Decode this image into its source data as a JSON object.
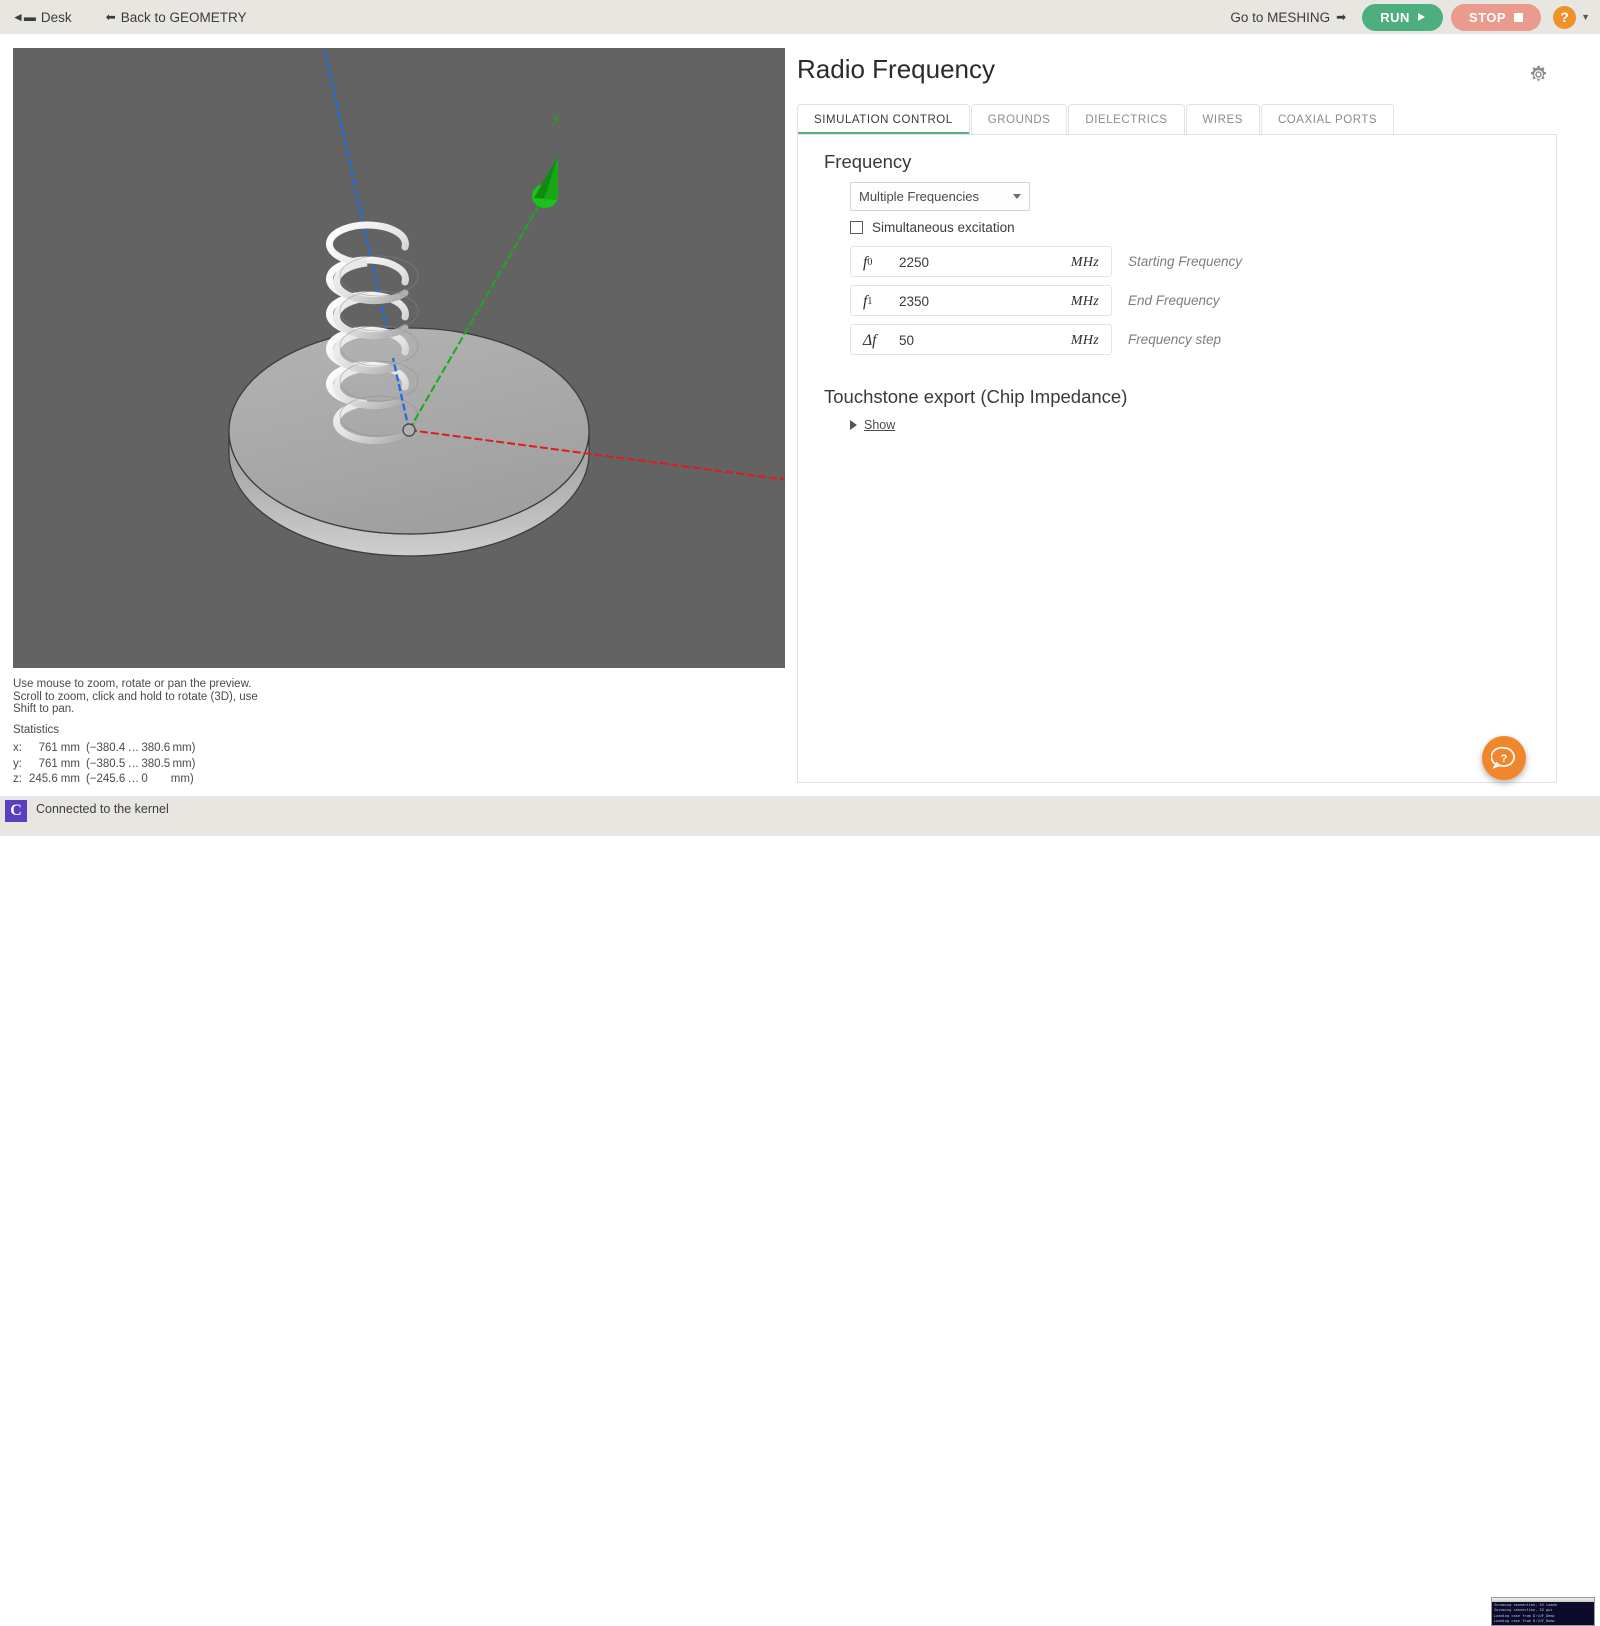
{
  "topbar": {
    "desk_label": "Desk",
    "desk_icon": "double-arrow-left-icon",
    "back_label": "Back to GEOMETRY",
    "back_icon": "arrow-left-icon",
    "goto_label": "Go to MESHING",
    "goto_icon": "arrow-right-icon",
    "run_label": "RUN",
    "run_icon": "play-icon",
    "stop_label": "STOP",
    "stop_icon": "stop-square-icon",
    "help_label": "?",
    "help_caret": "▼",
    "run_color": "#4caf7d",
    "stop_color": "#eb9a8e",
    "help_color": "#f0922b"
  },
  "viewport": {
    "axis_label_y": "y",
    "axis_color_x": "#e01b1b",
    "axis_color_y": "#18ac18",
    "axis_color_z": "#1e6ee0",
    "focus_icon": "center-focus-icon",
    "expand_icon": "expand-arrows-icon",
    "background_color": "#636363"
  },
  "hints": {
    "line1": "Use mouse to zoom, rotate or pan the preview.",
    "line2": "Scroll to zoom, click and hold to rotate (3D), use",
    "line3": "Shift to pan."
  },
  "statistics": {
    "title": "Statistics",
    "rows": [
      {
        "axis": "x:",
        "size": "761",
        "unit": "mm",
        "range": "(−380.4 … 380.6 mm)"
      },
      {
        "axis": "y:",
        "size": "761",
        "unit": "mm",
        "range": "(−380.5 … 380.5 mm)"
      },
      {
        "axis": "z:",
        "size": "245.6",
        "unit": "mm",
        "range": "(−245.6 … 0  mm)"
      }
    ]
  },
  "panel": {
    "title": "Radio Frequency",
    "gear_icon": "gear-icon",
    "tabs": [
      {
        "label": "SIMULATION CONTROL",
        "active": true
      },
      {
        "label": "GROUNDS",
        "active": false
      },
      {
        "label": "DIELECTRICS",
        "active": false
      },
      {
        "label": "WIRES",
        "active": false
      },
      {
        "label": "COAXIAL PORTS",
        "active": false
      }
    ],
    "active_tab_accent": "#55b37c"
  },
  "frequency": {
    "heading": "Frequency",
    "mode_value": "Multiple Frequencies",
    "mode_caret_icon": "chevron-down-icon",
    "simultaneous_excitation_label": "Simultaneous excitation",
    "simultaneous_excitation_checked": false,
    "fields": [
      {
        "sym": "f",
        "sub": "0",
        "value": "2250",
        "placeholder": "2250",
        "unit": "MHz",
        "desc": "Starting Frequency"
      },
      {
        "sym": "f",
        "sub": "1",
        "value": "2350",
        "placeholder": "2350",
        "unit": "MHz",
        "desc": "End Frequency"
      },
      {
        "sym": "Δf",
        "sub": "",
        "value": "50",
        "placeholder": "50",
        "unit": "MHz",
        "desc": "Frequency step"
      }
    ]
  },
  "touchstone": {
    "heading": "Touchstone export (Chip Impedance)",
    "show_label": "Show",
    "show_icon": "triangle-right-icon",
    "expanded": false
  },
  "fab": {
    "icon": "help-bubble-icon",
    "color": "#f0882b"
  },
  "statusbar": {
    "kernel_logo": "C",
    "kernel_status": "Connected to the kernel",
    "console_lines": [
      "Incoming connection, ID loade",
      "Incoming connection, ID gui",
      "Loading case from D:\\UF_Demo",
      "Loading case from D:\\UF_Demo"
    ]
  }
}
